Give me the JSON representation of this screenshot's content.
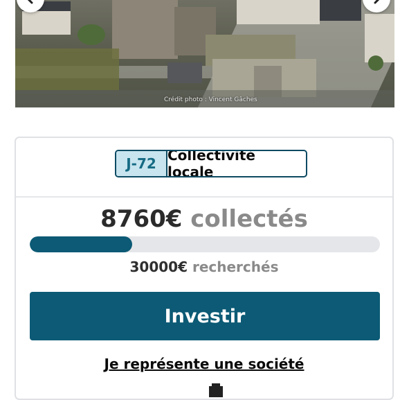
{
  "photo": {
    "credit": "Crédit photo : Vincent Gâches",
    "nav_prev_icon": "chevron-left-icon",
    "nav_next_icon": "chevron-right-icon"
  },
  "card": {
    "countdown_label": "J-72",
    "category_label": "Collectivité locale",
    "raised_amount": "8760€",
    "raised_suffix": "collectés",
    "target_amount": "30000€",
    "target_suffix": "recherchés",
    "progress_percent": 29.2,
    "invest_label": "Investir",
    "company_link_label": "Je représente une société",
    "bottom_icon": "building-icon"
  },
  "colors": {
    "primary": "#0c5a75",
    "tag_bg": "#c7e4ef",
    "track": "#e5e6e9",
    "muted_text": "#8a8a8a"
  }
}
